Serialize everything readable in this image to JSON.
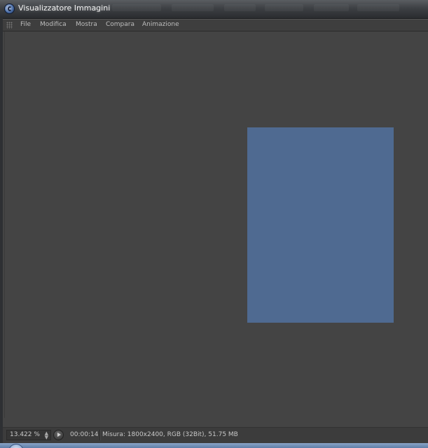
{
  "window": {
    "title": "Visualizzatore Immagini"
  },
  "menu": {
    "items": [
      {
        "label": "File"
      },
      {
        "label": "Modifica"
      },
      {
        "label": "Mostra"
      },
      {
        "label": "Compara"
      },
      {
        "label": "Animazione"
      }
    ]
  },
  "viewport": {
    "image_color": "#4f6a91"
  },
  "statusbar": {
    "zoom": "13.422 %",
    "time": "00:00:14",
    "info": "Misura: 1800x2400, RGB (32Bit), 51.75 MB"
  },
  "icons": {
    "app": "cinema4d-icon",
    "grip": "grip-icon",
    "play": "play-icon",
    "spinner": "spinner-arrows-icon"
  },
  "colors": {
    "background": "#444444",
    "menu_text": "#bdbdbd",
    "title_text": "#f2f2f2"
  }
}
